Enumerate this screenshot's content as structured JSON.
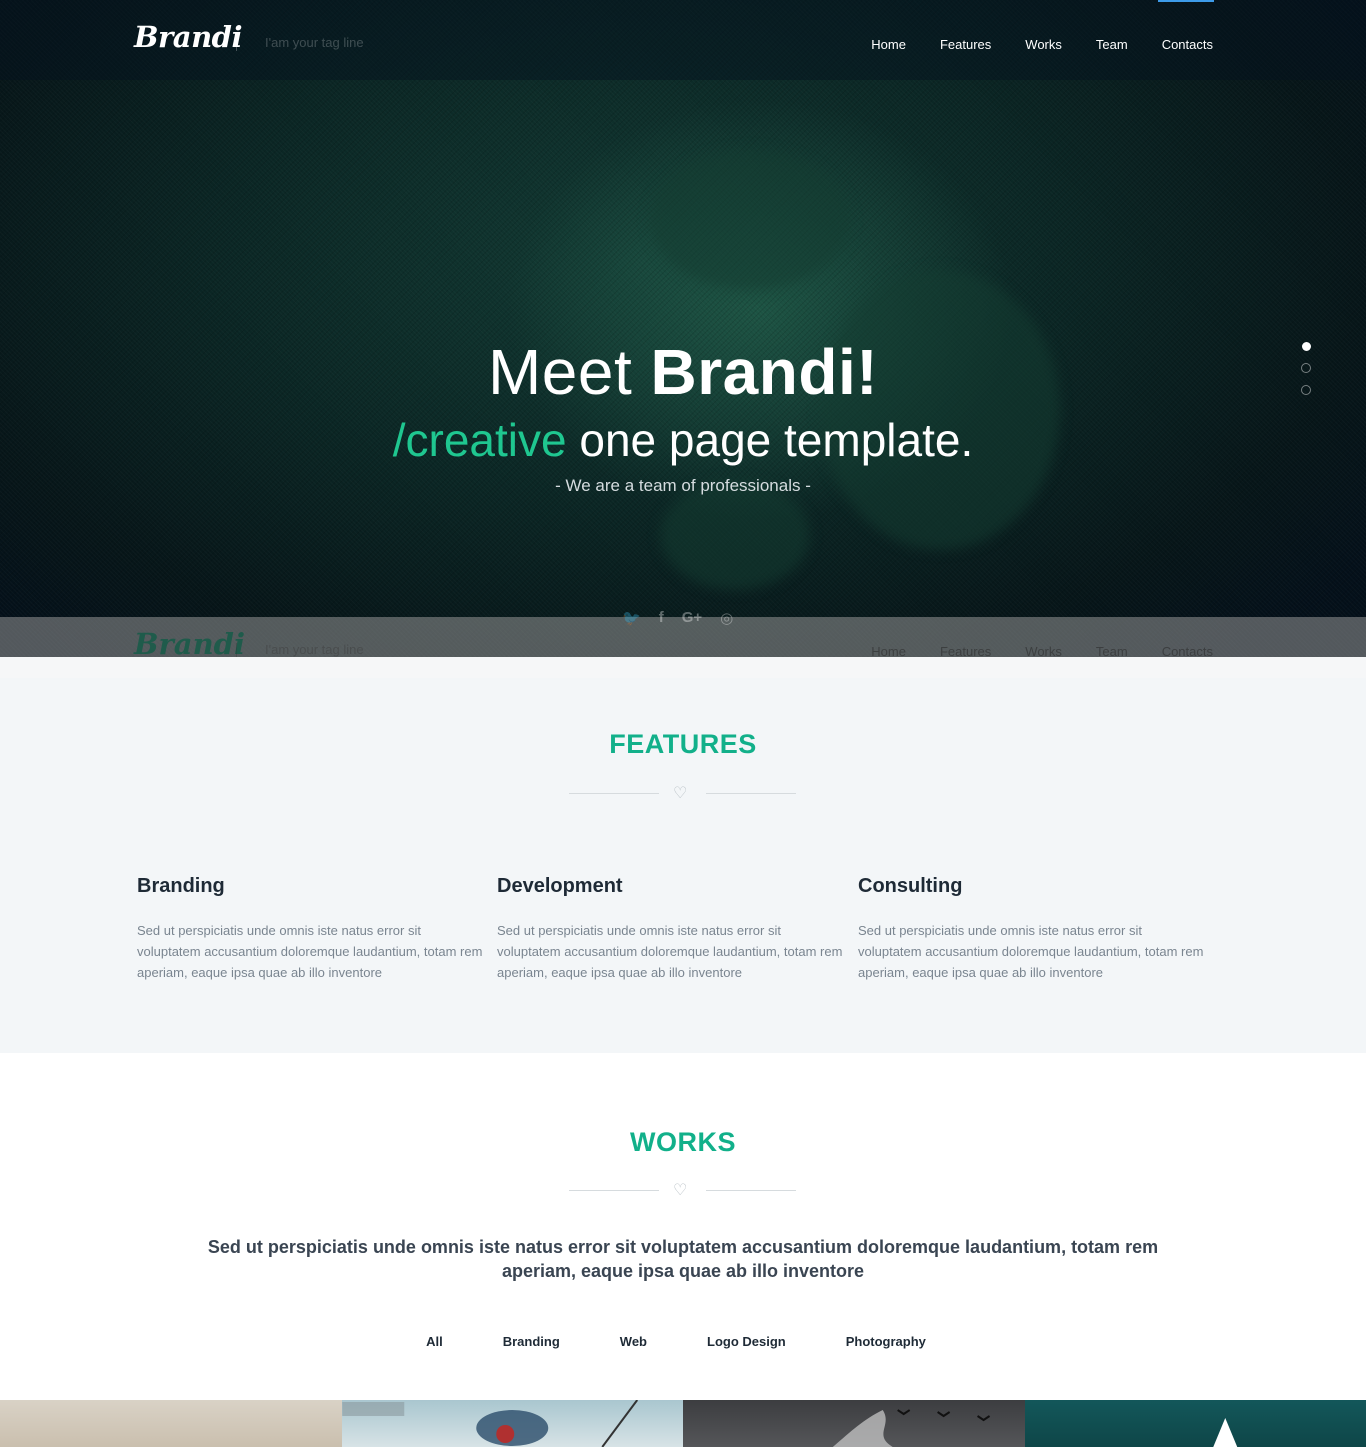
{
  "header": {
    "logo": "Brandi",
    "tagline": "I'am your tag line",
    "nav": [
      "Home",
      "Features",
      "Works",
      "Team",
      "Contacts"
    ]
  },
  "hero": {
    "line1_pre": "Meet ",
    "line1_bold": "Brandi!",
    "line2_accent": "/creative",
    "line2_rest": " one page template.",
    "line3": "- We are a team of professionals -",
    "slide_count": 3,
    "active_slide": 1,
    "socials": [
      "twitter-icon",
      "facebook-icon",
      "google-plus-icon",
      "dribbble-icon"
    ]
  },
  "features": {
    "title": "FEATURES",
    "items": [
      {
        "title": "Branding",
        "text": "Sed ut perspiciatis unde omnis iste natus error sit voluptatem accusantium doloremque laudantium, totam rem aperiam, eaque ipsa quae ab illo inventore"
      },
      {
        "title": "Development",
        "text": "Sed ut perspiciatis unde omnis iste natus error sit voluptatem accusantium doloremque laudantium, totam rem aperiam, eaque ipsa quae ab illo inventore"
      },
      {
        "title": "Consulting",
        "text": "Sed ut perspiciatis unde omnis iste natus error sit voluptatem accusantium doloremque laudantium, totam rem aperiam, eaque ipsa quae ab illo inventore"
      }
    ]
  },
  "works": {
    "title": "WORKS",
    "lead": "Sed ut perspiciatis unde omnis iste natus error sit voluptatem accusantium doloremque laudantium, totam rem aperiam, eaque ipsa quae ab illo inventore",
    "filters": [
      "All",
      "Branding",
      "Web",
      "Logo Design",
      "Photography"
    ]
  },
  "colors": {
    "accent": "#12b08a",
    "hero_accent": "#1fc790",
    "nav_active": "#3d9be9"
  }
}
